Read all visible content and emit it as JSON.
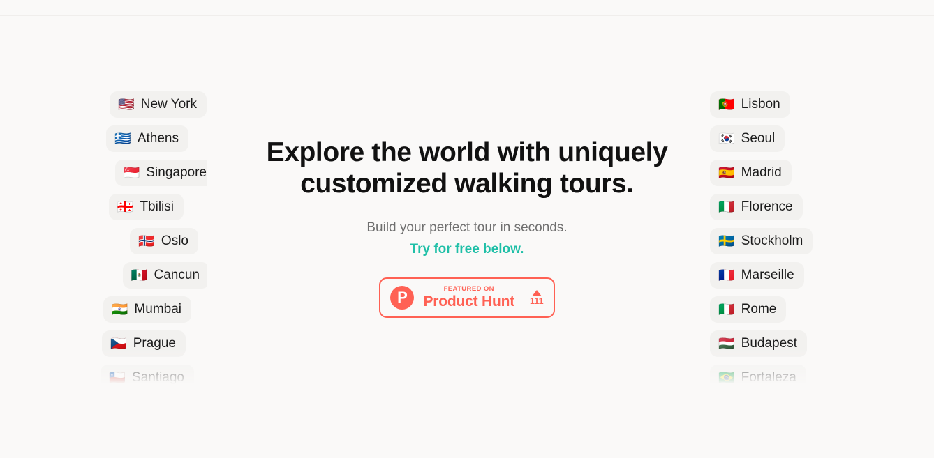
{
  "theme": {
    "background": "#faf9f8",
    "chip_background": "#f2f1ef",
    "text_primary": "#111111",
    "text_muted": "#6f6f6f",
    "accent_teal": "#1fbfa7",
    "accent_coral": "#ff6154"
  },
  "hero": {
    "headline": "Explore the world with uniquely customized walking tours.",
    "subhead": "Build your perfect tour in seconds.",
    "cta_line": "Try for free below."
  },
  "product_hunt": {
    "eyebrow": "FEATURED ON",
    "title": "Product Hunt",
    "upvote_icon": "triangle-up-icon",
    "upvote_count": "111"
  },
  "city_columns": {
    "left": [
      {
        "flag": "🇺🇸",
        "flag_name": "flag-united-states",
        "city": "New York"
      },
      {
        "flag": "🇬🇷",
        "flag_name": "flag-greece",
        "city": "Athens"
      },
      {
        "flag": "🇸🇬",
        "flag_name": "flag-singapore",
        "city": "Singapore"
      },
      {
        "flag": "🇬🇪",
        "flag_name": "flag-georgia",
        "city": "Tbilisi"
      },
      {
        "flag": "🇳🇴",
        "flag_name": "flag-norway",
        "city": "Oslo"
      },
      {
        "flag": "🇲🇽",
        "flag_name": "flag-mexico",
        "city": "Cancun"
      },
      {
        "flag": "🇮🇳",
        "flag_name": "flag-india",
        "city": "Mumbai"
      },
      {
        "flag": "🇨🇿",
        "flag_name": "flag-czech-republic",
        "city": "Prague"
      },
      {
        "flag": "🇨🇱",
        "flag_name": "flag-chile",
        "city": "Santiago"
      }
    ],
    "right": [
      {
        "flag": "🇵🇹",
        "flag_name": "flag-portugal",
        "city": "Lisbon"
      },
      {
        "flag": "🇰🇷",
        "flag_name": "flag-south-korea",
        "city": "Seoul"
      },
      {
        "flag": "🇪🇸",
        "flag_name": "flag-spain",
        "city": "Madrid"
      },
      {
        "flag": "🇮🇹",
        "flag_name": "flag-italy",
        "city": "Florence"
      },
      {
        "flag": "🇸🇪",
        "flag_name": "flag-sweden",
        "city": "Stockholm"
      },
      {
        "flag": "🇫🇷",
        "flag_name": "flag-france",
        "city": "Marseille"
      },
      {
        "flag": "🇮🇹",
        "flag_name": "flag-italy",
        "city": "Rome"
      },
      {
        "flag": "🇭🇺",
        "flag_name": "flag-hungary",
        "city": "Budapest"
      },
      {
        "flag": "🇧🇷",
        "flag_name": "flag-brazil",
        "city": "Fortaleza"
      }
    ]
  },
  "left_column_offsets": [
    0,
    26,
    -14,
    33,
    12,
    -4,
    22,
    30,
    18
  ]
}
